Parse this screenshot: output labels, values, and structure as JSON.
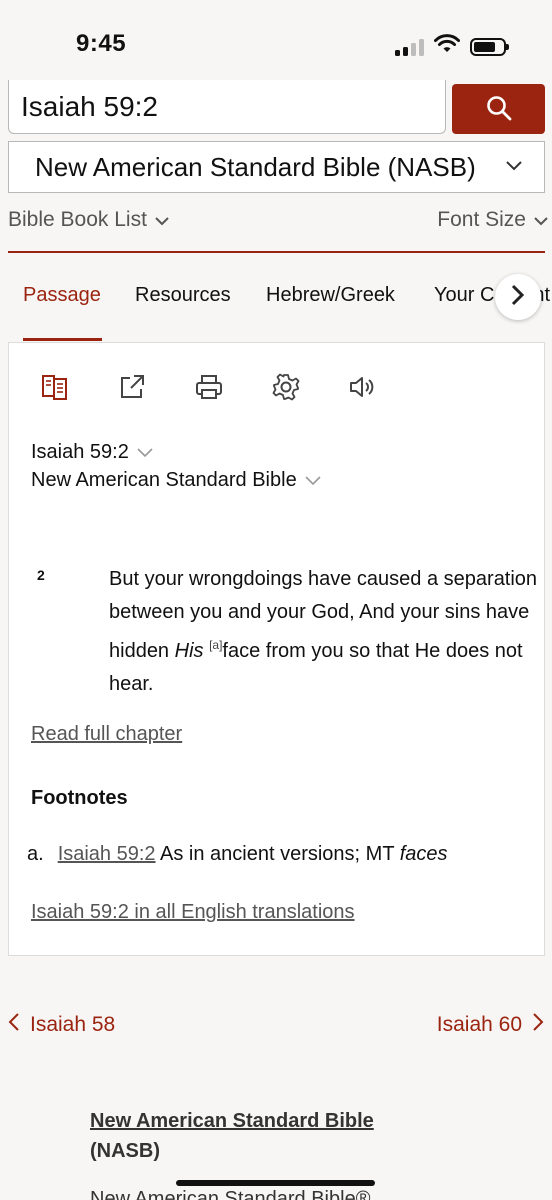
{
  "status_bar": {
    "time": "9:45"
  },
  "search": {
    "value": "Isaiah 59:2"
  },
  "version_select": {
    "label": "New American Standard Bible (NASB)"
  },
  "toolbar": {
    "book_list": "Bible Book List",
    "font_size": "Font Size"
  },
  "tabs": [
    {
      "label": "Passage",
      "active": true
    },
    {
      "label": "Resources",
      "active": false
    },
    {
      "label": "Hebrew/Greek",
      "active": false
    },
    {
      "label": "Your Content",
      "active": false
    }
  ],
  "icons": [
    "parallel-icon",
    "share-icon",
    "print-icon",
    "settings-icon",
    "audio-icon",
    "search-icon",
    "chevron-down-icon",
    "chevron-right-icon",
    "chevron-left-icon"
  ],
  "colors": {
    "accent": "#9b2410",
    "link_gray": "#555555"
  },
  "passage": {
    "reference": "Isaiah 59:2",
    "version": "New American Standard Bible",
    "verse_number": "2",
    "text_part1": "But your wrongdoings have caused a separation between you and your God, And your sins have hidden ",
    "text_italic": "His",
    "footnote_marker": "[a]",
    "text_part2": "face from you so that He does not hear.",
    "read_full_chapter": "Read full chapter"
  },
  "footnotes": {
    "heading": "Footnotes",
    "items": [
      {
        "marker": "a.",
        "ref": "Isaiah 59:2",
        "text": "As in ancient versions; MT ",
        "italic": "faces"
      }
    ],
    "all_translations": "Isaiah 59:2 in all English translations"
  },
  "navigation": {
    "prev": "Isaiah 58",
    "next": "Isaiah 60"
  },
  "footer": {
    "title": "New American Standard Bible",
    "abbr": "(NASB)",
    "copyright": "New American Standard Bible®"
  }
}
